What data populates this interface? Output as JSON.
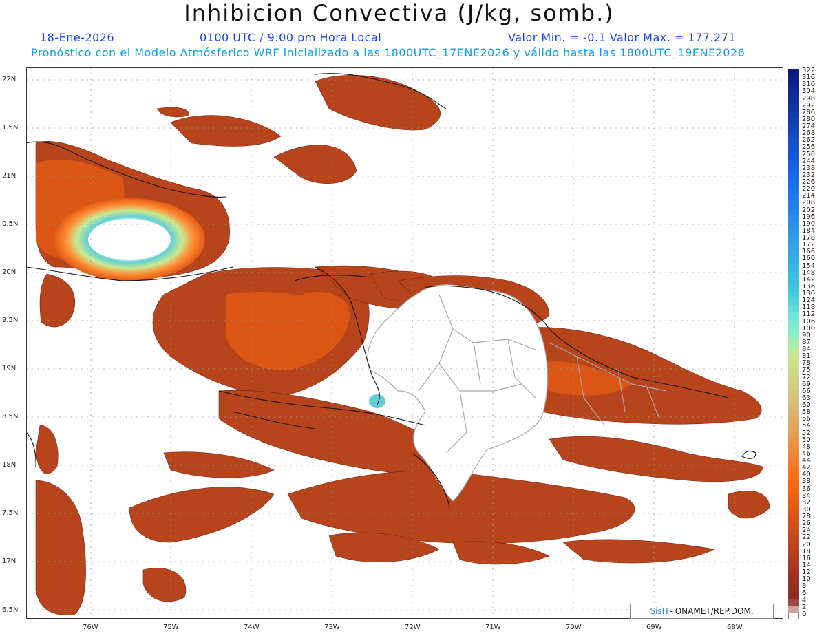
{
  "header": {
    "title": "Inhibicion Convectiva (J/kg, somb.)",
    "date": "18-Ene-2026",
    "time": "0100 UTC / 9:00 pm Hora Local",
    "minmax": "Valor Min. = -0.1  Valor Max. = 177.271",
    "forecast": "Pronóstico con el Modelo Atmósferico WRF inicializado a las 1800UTC_17ENE2026 y válido hasta las  1800UTC_19ENE2026"
  },
  "map": {
    "lat_labels": [
      "22N",
      "1.5N",
      "21N",
      "0.5N",
      "20N",
      "9.5N",
      "19N",
      "8.5N",
      "18N",
      "7.5N",
      "17N",
      "6.5N"
    ],
    "lon_labels": [
      "76W",
      "75W",
      "74W",
      "73W",
      "72W",
      "71W",
      "70W",
      "69W",
      "68W"
    ]
  },
  "colorbar": {
    "labels": [
      "322",
      "316",
      "310",
      "304",
      "298",
      "292",
      "286",
      "280",
      "274",
      "268",
      "262",
      "256",
      "250",
      "244",
      "238",
      "232",
      "226",
      "220",
      "214",
      "208",
      "202",
      "196",
      "190",
      "184",
      "178",
      "172",
      "166",
      "160",
      "154",
      "148",
      "142",
      "136",
      "130",
      "124",
      "118",
      "112",
      "106",
      "100",
      "90",
      "87",
      "84",
      "81",
      "78",
      "75",
      "72",
      "69",
      "66",
      "63",
      "60",
      "58",
      "56",
      "54",
      "52",
      "50",
      "48",
      "46",
      "44",
      "42",
      "40",
      "38",
      "36",
      "34",
      "32",
      "30",
      "28",
      "26",
      "24",
      "22",
      "20",
      "18",
      "16",
      "14",
      "12",
      "10",
      "8",
      "6",
      "4",
      "2",
      "0"
    ],
    "colors": {
      "deep_blue": "#0a1a80",
      "blue": "#1a6cf0",
      "cyan": "#40c8e0",
      "aqua": "#80f0d0",
      "green_yellow": "#c8e890",
      "tan": "#d8b878",
      "orange": "#ff6a10",
      "rust": "#b8401e",
      "brown": "#8a2a22"
    }
  },
  "credit": {
    "brand": "SisΠ",
    "text": "- ONAMET/REP.DOM."
  },
  "colors": {
    "field_base": "#b8441c",
    "field_dark": "#9a3a1e",
    "field_orange": "#e25a14",
    "grid": "#9a9a9a",
    "coast": "#111111",
    "border": "#a8a8a8"
  }
}
